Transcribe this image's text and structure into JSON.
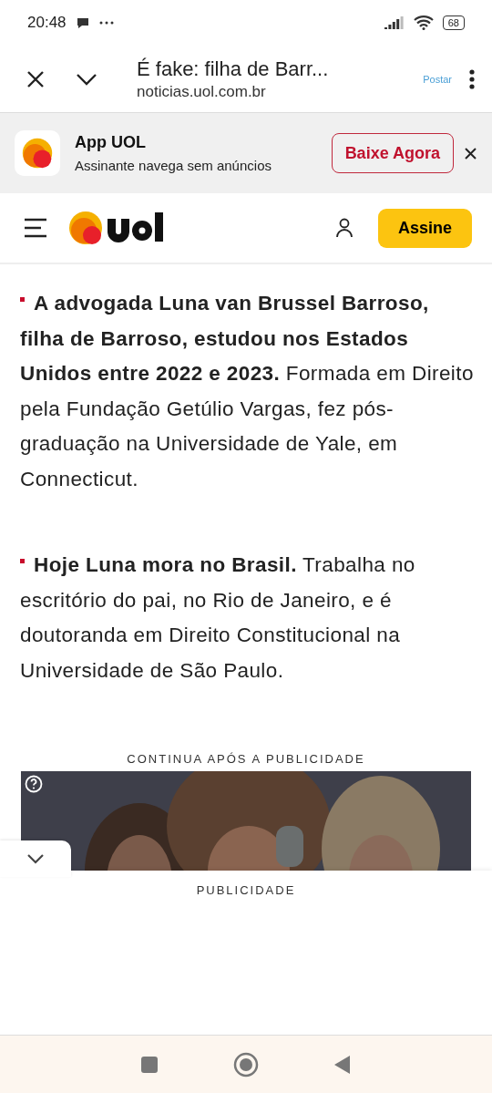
{
  "status_bar": {
    "time": "20:48",
    "battery": "68"
  },
  "toolbar": {
    "title": "É fake: filha de Barr...",
    "url": "noticias.uol.com.br",
    "action": "Postar"
  },
  "app_banner": {
    "title": "App UOL",
    "subtitle": "Assinante navega sem anúncios",
    "button": "Baixe Agora"
  },
  "header": {
    "subscribe": "Assine"
  },
  "article": {
    "paragraphs": [
      "**A advogada Luna van Brussel Barroso, filha de Barroso, estudou nos Estados Unidos entre 2022 e 2023.** Formada em Direito pela Fundação Getúlio Vargas, fez pós-graduação na Universidade de Yale, em Connecticut.",
      "**Hoje Luna mora no Brasil.** Trabalha no escritório do pai, no Rio de Janeiro, e é doutoranda em Direito Constitucional na Universidade de São Paulo."
    ]
  },
  "ad": {
    "label": "CONTINUA APÓS A PUBLICIDADE"
  },
  "ad_sheet": {
    "label": "PUBLICIDADE"
  }
}
